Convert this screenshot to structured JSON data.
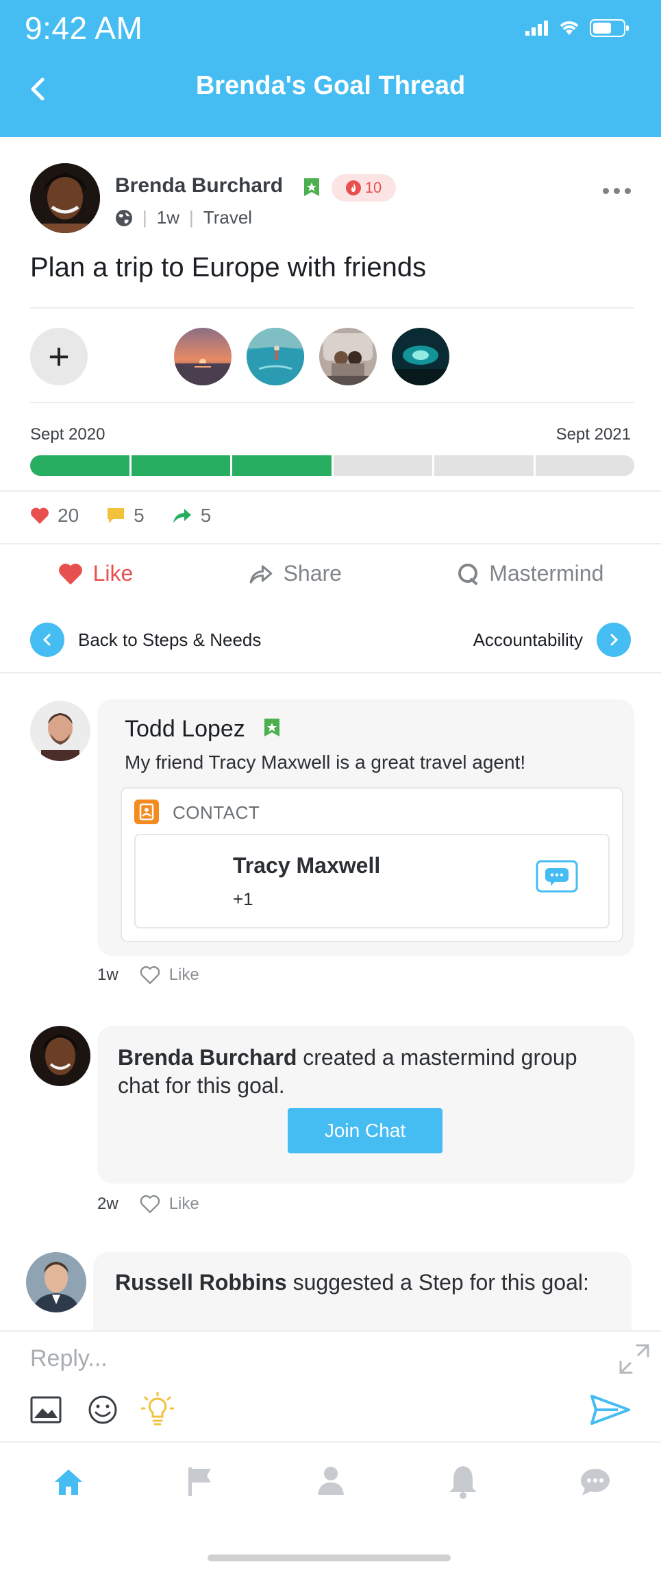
{
  "status_bar": {
    "time": "9:42 AM"
  },
  "header": {
    "title": "Brenda's Goal Thread"
  },
  "post": {
    "author": "Brenda Burchard",
    "streak": "10",
    "age": "1w",
    "category": "Travel",
    "goal": "Plan a trip to Europe with friends",
    "add_label": "+",
    "timeline": {
      "start": "Sept 2020",
      "end": "Sept 2021",
      "progress_segments_done": 3,
      "progress_segments_total": 6
    },
    "stats": {
      "likes": "20",
      "comments": "5",
      "shares": "5"
    },
    "actions": {
      "like": "Like",
      "share": "Share",
      "mastermind": "Mastermind"
    },
    "nav": {
      "back": "Back to Steps & Needs",
      "forward": "Accountability"
    }
  },
  "comments": [
    {
      "name": "Todd Lopez",
      "text": "My friend Tracy Maxwell is a great travel agent!",
      "contact_label": "CONTACT",
      "contact_name": "Tracy Maxwell",
      "contact_phone": "+1",
      "age": "1w",
      "like": "Like"
    },
    {
      "name": "Brenda Burchard",
      "text": " created a mastermind group chat for this goal.",
      "button": "Join Chat",
      "age": "2w",
      "like": "Like"
    },
    {
      "name": "Russell Robbins",
      "text": " suggested a Step for this goal:"
    }
  ],
  "reply": {
    "placeholder": "Reply..."
  },
  "colors": {
    "accent": "#45bdf2",
    "progress": "#27ae60",
    "like": "#e8504f",
    "streak_bg": "#fde4e4",
    "verified": "#4caf50"
  }
}
